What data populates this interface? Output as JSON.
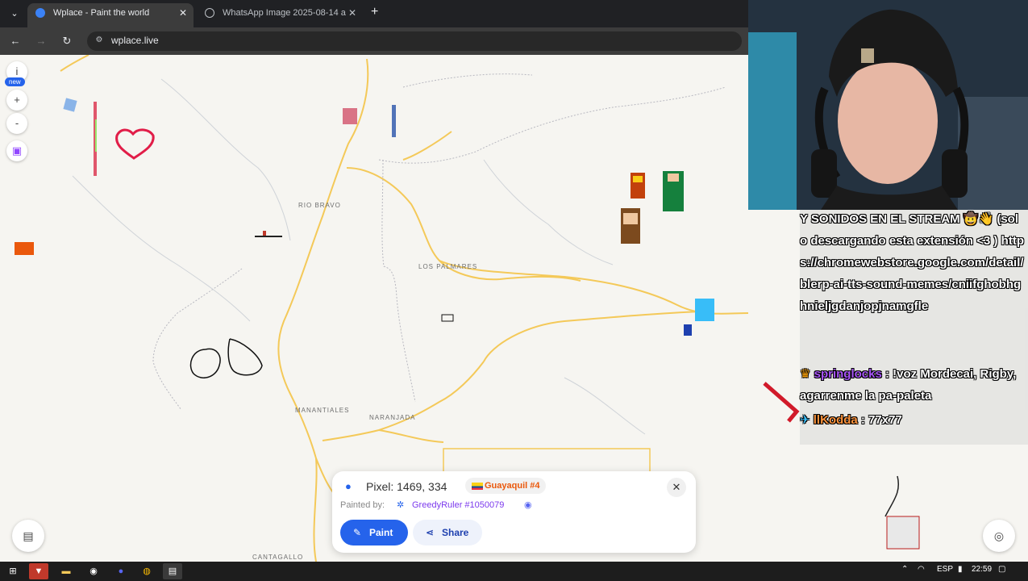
{
  "browser": {
    "tabs": [
      {
        "title": "Wplace - Paint the world",
        "active": true,
        "favicon": "globe-favicon"
      },
      {
        "title": "WhatsApp Image 2025-08-14 a",
        "active": false,
        "favicon": "globe-favicon"
      }
    ],
    "url": "wplace.live",
    "icons": {
      "back": "←",
      "forward": "→",
      "reload": "↻",
      "close": "✕",
      "new_tab": "+",
      "tab_menu": "⌄",
      "site_info": "⚙"
    }
  },
  "map": {
    "places": [
      "RIO BRAVO",
      "LOS PALMARES",
      "MANANTIALES",
      "NARANJADA",
      "CANTAGALLO"
    ],
    "controls": {
      "info": "i",
      "new_badge": "new",
      "zoom_in": "+",
      "zoom_out": "-"
    },
    "road_color": "#f4c959"
  },
  "popup": {
    "pixel_label": "Pixel: 1469, 334",
    "region": "Guayaquil #4",
    "painted_by_label": "Painted by:",
    "painter": "GreedyRuler #1050079",
    "paint_button": "Paint",
    "share_button": "Share",
    "accent": "#2563eb"
  },
  "chat": {
    "message1": "Y SONIDOS EN EL STREAM 🤠👋 (solo descargando esta extensión <3 ) https://chromewebstore.google.com/detail/blerp-ai-tts-sound-memes/cniifghobhghnieljgdanjopjnamgfle",
    "user1": "springlocks",
    "message2": " : !voz Mordecai, Rigby, agarrenme la pa-paleta",
    "user2": "llKodda",
    "message3": " : 77x77"
  },
  "taskbar": {
    "language": "ESP",
    "time": "22:59"
  }
}
